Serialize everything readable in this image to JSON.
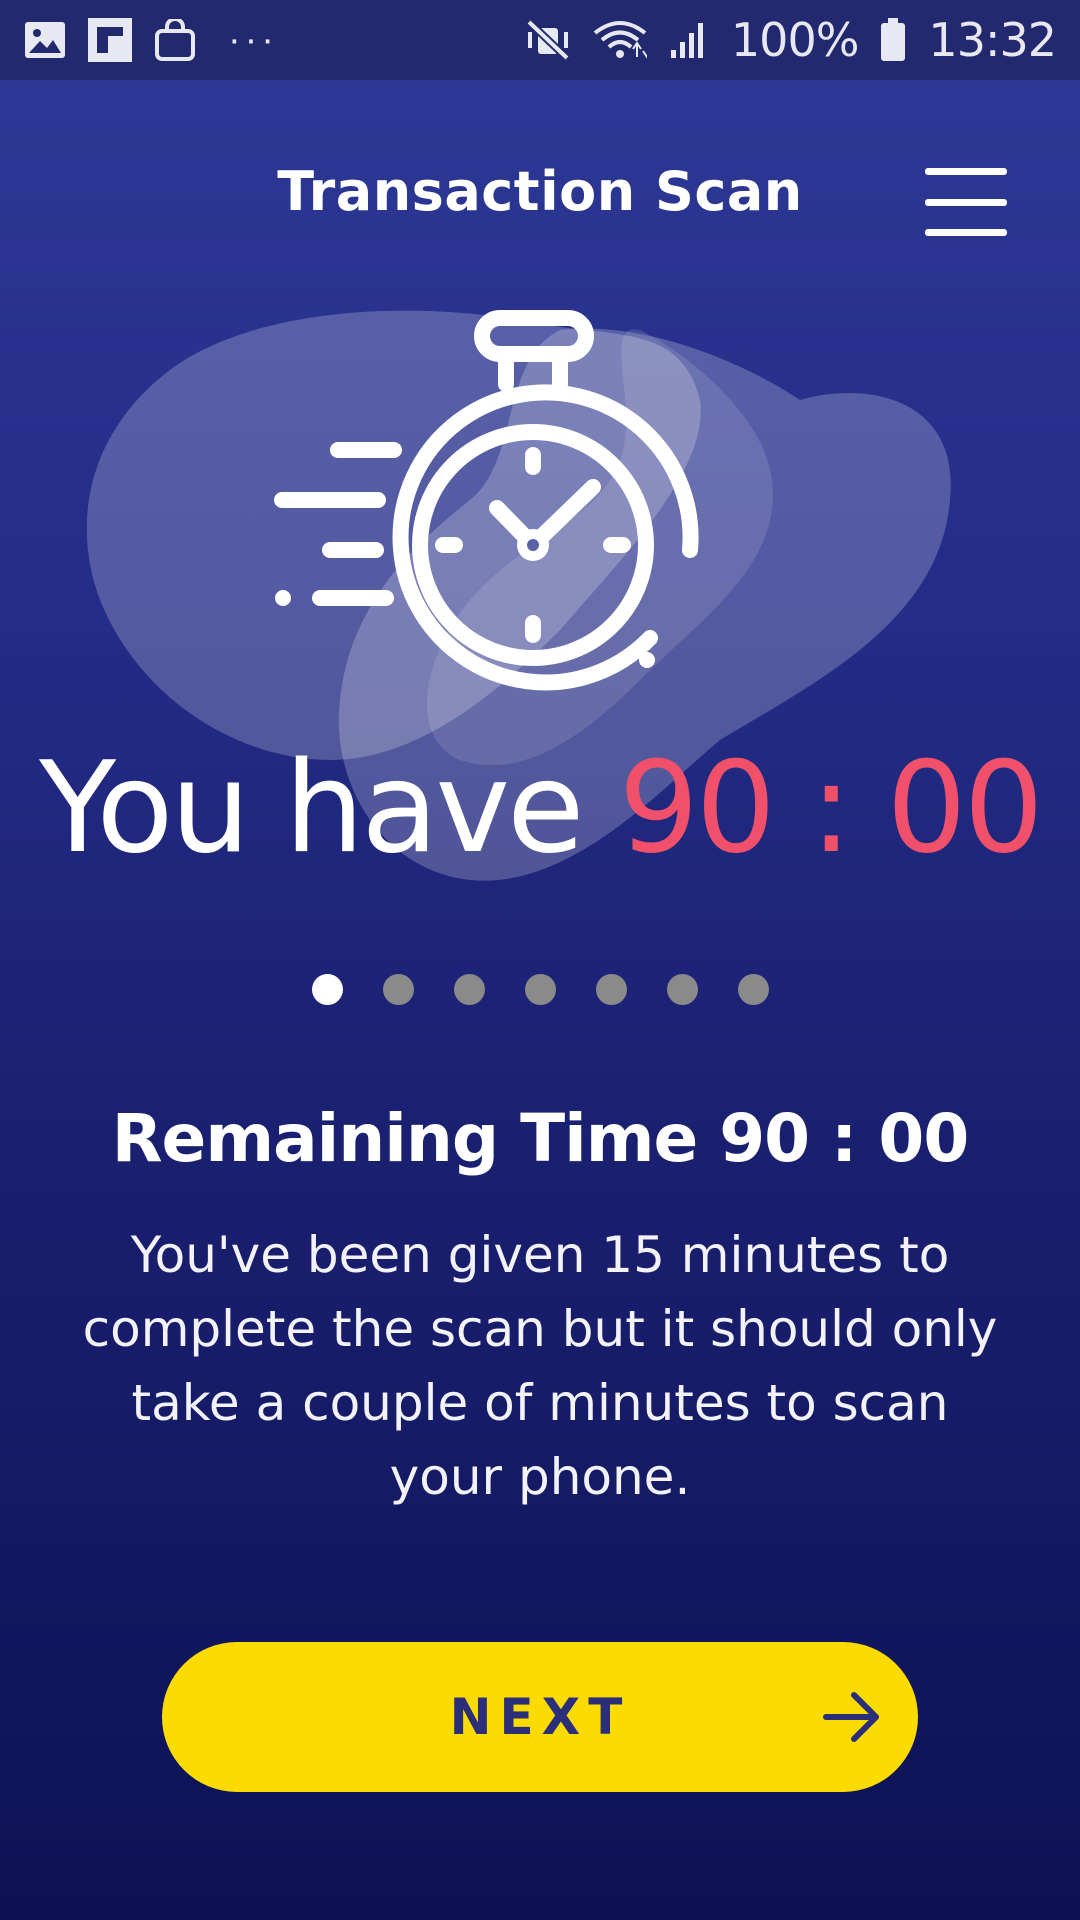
{
  "status_bar": {
    "battery": "100%",
    "time": "13:32",
    "left_icons": [
      "gallery-icon",
      "flipboard-icon",
      "shopping-bag-icon"
    ],
    "right_icons": [
      "mute-icon",
      "wifi-icon",
      "signal-icon",
      "battery-icon"
    ]
  },
  "header": {
    "title": "Transaction Scan",
    "menu_icon": "hamburger-menu-icon"
  },
  "hero": {
    "icon": "stopwatch-icon",
    "prefix": "You have",
    "time": "90 : 00"
  },
  "pagination": {
    "total": 7,
    "active_index": 0
  },
  "content": {
    "title": "Remaining Time 90 : 00",
    "description": "You've been given 15 minutes to complete the scan but it should only take a couple of minutes to scan your phone."
  },
  "actions": {
    "next_label": "NEXT",
    "next_icon": "arrow-right-icon"
  },
  "colors": {
    "background_top": "#2e3a96",
    "background_bottom": "#0c1253",
    "accent_time": "#f0506a",
    "button": "#fcdc00",
    "button_text": "#2b2f7a"
  }
}
